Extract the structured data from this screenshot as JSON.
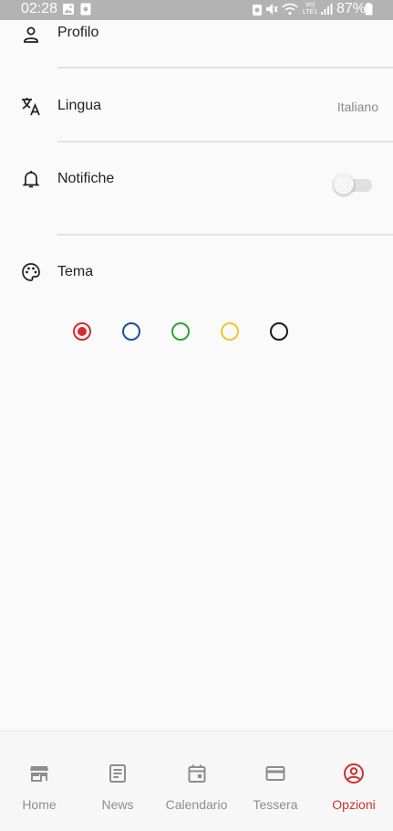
{
  "status_bar": {
    "time": "02:28",
    "network": "Vo)\nLTE1",
    "battery": "87%"
  },
  "settings": {
    "profile_label": "Profilo",
    "language_label": "Lingua",
    "language_value": "Italiano",
    "notifications_label": "Notifiche",
    "notifications_enabled": false,
    "theme_label": "Tema",
    "theme_colors": [
      {
        "name": "red",
        "color": "#d32f2f",
        "selected": true
      },
      {
        "name": "blue",
        "color": "#1e4fa0",
        "selected": false
      },
      {
        "name": "green",
        "color": "#2ea52e",
        "selected": false
      },
      {
        "name": "yellow",
        "color": "#f2c230",
        "selected": false
      },
      {
        "name": "black",
        "color": "#1b1b1b",
        "selected": false
      }
    ]
  },
  "bottom_nav": {
    "items": [
      {
        "label": "Home",
        "icon": "store-icon",
        "active": false
      },
      {
        "label": "News",
        "icon": "article-icon",
        "active": false
      },
      {
        "label": "Calendario",
        "icon": "calendar-icon",
        "active": false
      },
      {
        "label": "Tessera",
        "icon": "card-icon",
        "active": false
      },
      {
        "label": "Opzioni",
        "icon": "account-circle-icon",
        "active": true
      }
    ]
  },
  "colors": {
    "accent": "#d32f2f",
    "inactive": "#8d8d8d",
    "background": "#fafafa"
  }
}
